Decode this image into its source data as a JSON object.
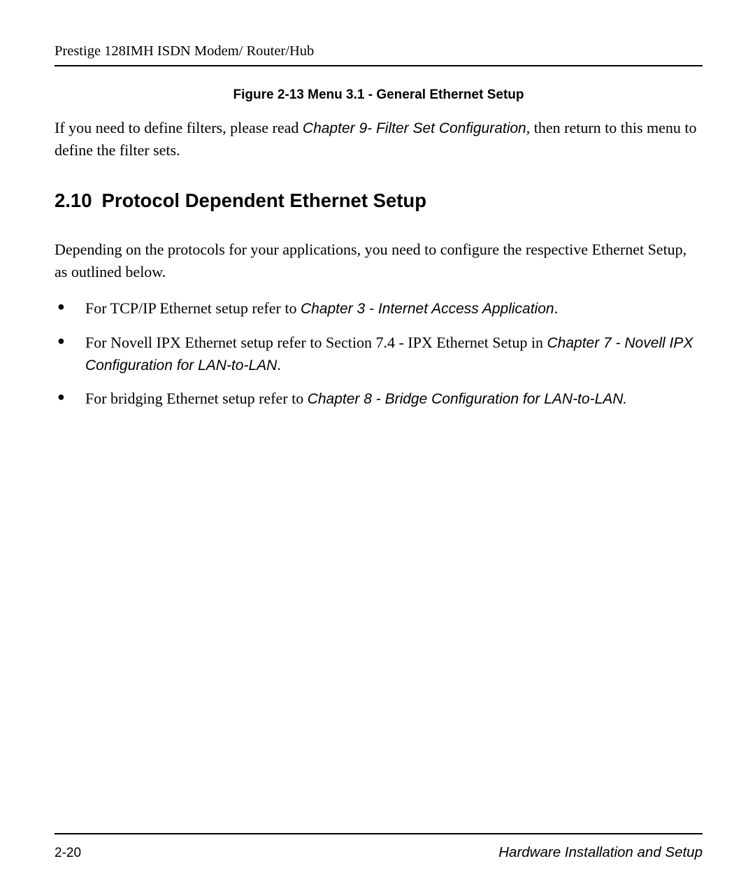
{
  "header": {
    "title": "Prestige 128IMH ISDN Modem/ Router/Hub"
  },
  "figure": {
    "caption": "Figure 2-13 Menu 3.1 - General Ethernet Setup"
  },
  "intro": {
    "text_1": "If you need to define filters, please read ",
    "ref_1": "Chapter 9- Filter Set Configuration",
    "text_2": ", then return to this menu to define the filter sets."
  },
  "section": {
    "number": "2.10",
    "title": "Protocol Dependent Ethernet Setup"
  },
  "body": {
    "paragraph": "Depending on the protocols for your applications, you need to configure the respective Ethernet Setup, as outlined below."
  },
  "bullets": [
    {
      "text_1": "For TCP/IP Ethernet setup refer to ",
      "ref_1": "Chapter 3 - Internet Access Application",
      "text_2": "."
    },
    {
      "text_1": "For Novell IPX Ethernet setup refer to Section 7.4 - IPX Ethernet Setup in ",
      "ref_1": "Chapter 7 - Novell IPX Configuration for LAN-to-LAN",
      "text_2": "."
    },
    {
      "text_1": "For bridging Ethernet setup refer to ",
      "ref_1": "Chapter 8 - Bridge Configuration for LAN-to-LAN.",
      "text_2": ""
    }
  ],
  "footer": {
    "page": "2-20",
    "title": "Hardware Installation and Setup"
  }
}
